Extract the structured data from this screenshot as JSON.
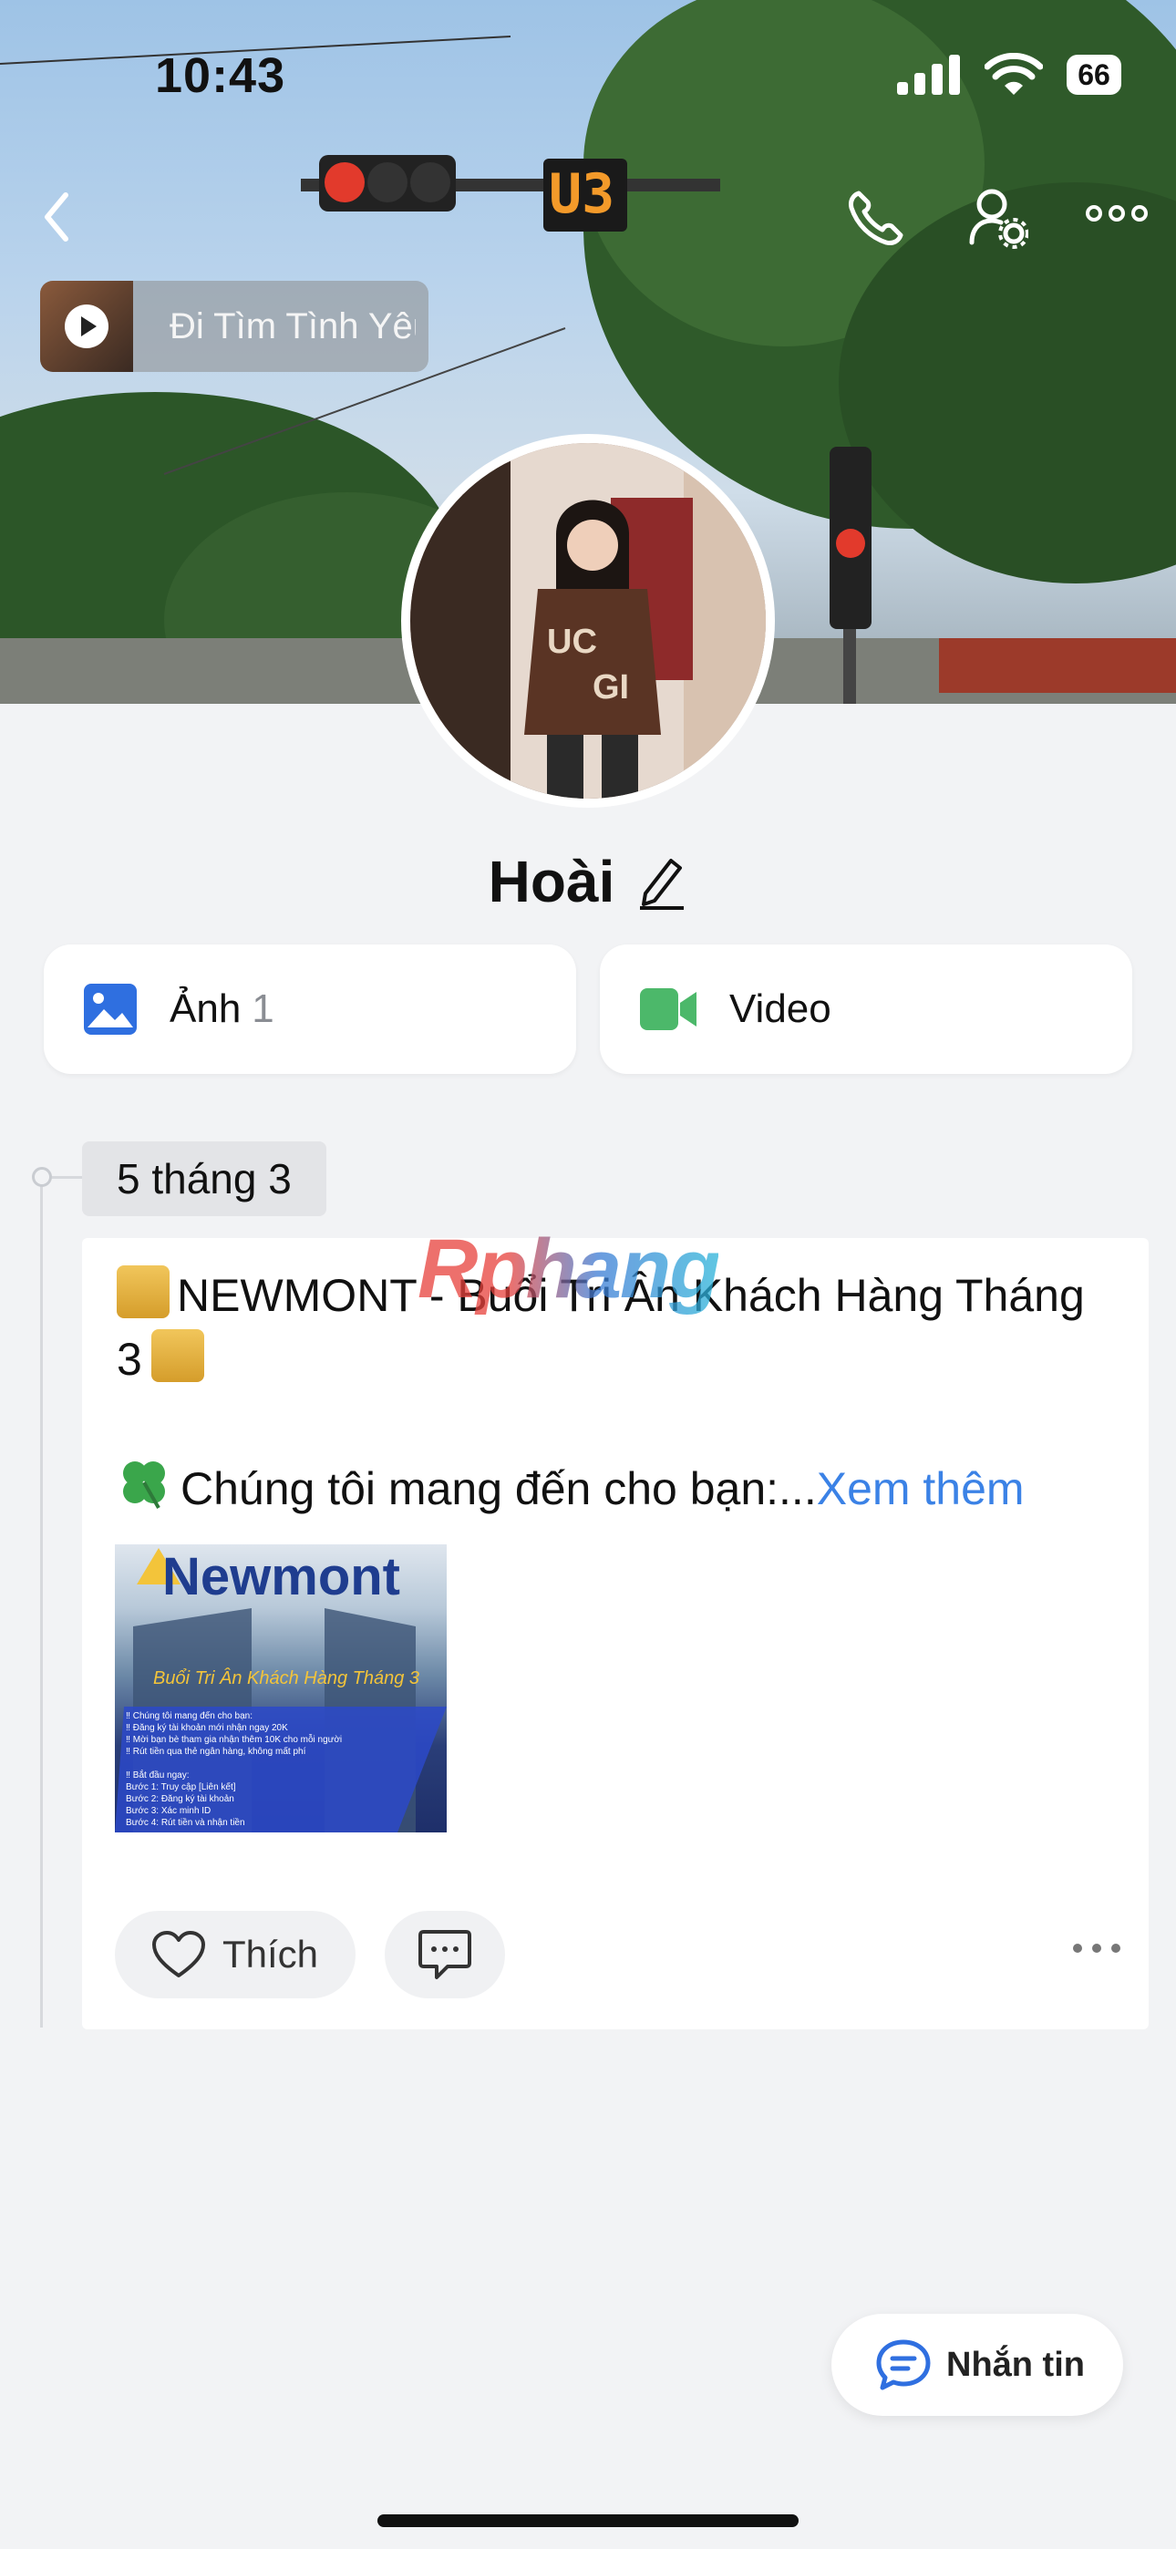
{
  "status_bar": {
    "time": "10:43",
    "battery": "66"
  },
  "cover": {
    "music_chip": {
      "title": "Đi Tìm Tình Yêu"
    },
    "traffic_counter": "U3"
  },
  "profile": {
    "name": "Hoài"
  },
  "media_buttons": [
    {
      "label": "Ảnh",
      "count": "1"
    },
    {
      "label": "Video",
      "count": ""
    }
  ],
  "timeline": {
    "date": "5 tháng 3",
    "post": {
      "line1": "NEWMONT - Buổi Tri Ân Khách Hàng Tháng 3",
      "line2": "Chúng tôi mang đến cho bạn:...",
      "see_more": "Xem thêm",
      "image": {
        "brand": "Newmont",
        "headline": "Buổi Tri Ân Khách Hàng Tháng 3",
        "body": "‼ Chúng tôi mang đến cho bạn:\n‼ Đăng ký tài khoản mới nhận ngay 20K\n‼ Mời bạn bè tham gia nhận thêm 10K cho mỗi người\n‼ Rút tiền qua thẻ ngân hàng, không mất phí\n\n‼ Bắt đầu ngay:\nBước 1: Truy cập [Liên kết]\nBước 2: Đăng ký tài khoản\nBước 3: Xác minh ID\nBước 4: Rút tiền và nhận tiền"
      },
      "like_label": "Thích"
    }
  },
  "watermark": "Rphang",
  "message_button": {
    "label": "Nhắn tin"
  },
  "colors": {
    "accent": "#3b82e6",
    "video_green": "#4cb86a",
    "photo_blue": "#2f6fe0"
  }
}
